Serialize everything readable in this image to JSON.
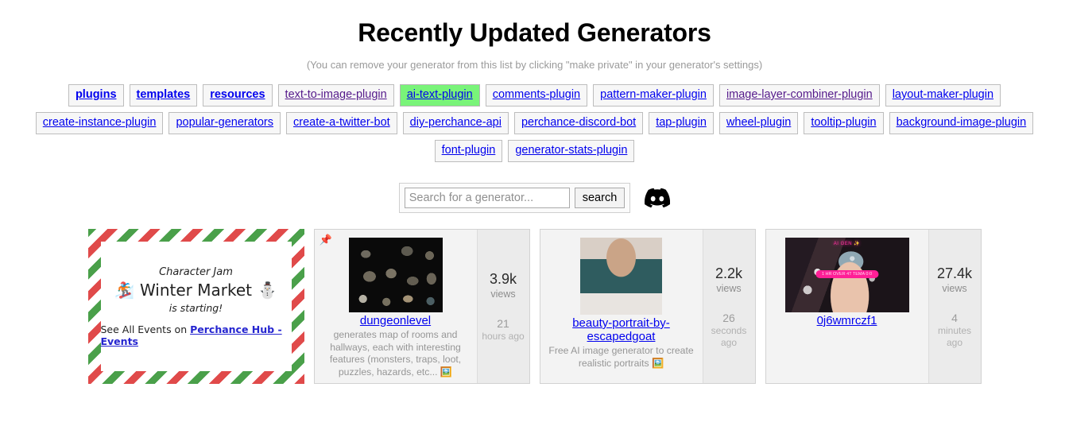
{
  "header": {
    "title": "Recently Updated Generators",
    "subtitle": "(You can remove your generator from this list by clicking \"make private\" in your generator's settings)"
  },
  "tag_rows": [
    [
      {
        "label": "plugins",
        "style": "bold"
      },
      {
        "label": "templates",
        "style": "bold"
      },
      {
        "label": "resources",
        "style": "bold"
      },
      {
        "label": "text-to-image-plugin",
        "style": "visited"
      },
      {
        "label": "ai-text-plugin",
        "style": "highlight"
      },
      {
        "label": "comments-plugin",
        "style": "normal"
      },
      {
        "label": "pattern-maker-plugin",
        "style": "normal"
      },
      {
        "label": "image-layer-combiner-plugin",
        "style": "visited"
      },
      {
        "label": "layout-maker-plugin",
        "style": "normal"
      }
    ],
    [
      {
        "label": "create-instance-plugin",
        "style": "normal"
      },
      {
        "label": "popular-generators",
        "style": "normal"
      },
      {
        "label": "create-a-twitter-bot",
        "style": "normal"
      },
      {
        "label": "diy-perchance-api",
        "style": "normal"
      },
      {
        "label": "perchance-discord-bot",
        "style": "normal"
      },
      {
        "label": "tap-plugin",
        "style": "normal"
      },
      {
        "label": "wheel-plugin",
        "style": "normal"
      },
      {
        "label": "tooltip-plugin",
        "style": "normal"
      },
      {
        "label": "background-image-plugin",
        "style": "normal"
      }
    ],
    [
      {
        "label": "font-plugin",
        "style": "normal"
      },
      {
        "label": "generator-stats-plugin",
        "style": "normal"
      }
    ]
  ],
  "search": {
    "placeholder": "Search for a generator...",
    "value": "",
    "button_label": "search",
    "discord_icon": "discord-icon"
  },
  "event_card": {
    "jam_label": "Character Jam",
    "emoji_left": "🏂",
    "main_label": "Winter Market",
    "emoji_right": "⛄",
    "starting_label": "is starting!",
    "footer_prefix": "See All Events on",
    "footer_link": "Perchance Hub - Events",
    "border_colors": {
      "red": "#e04a4a",
      "green": "#4aa04a",
      "white": "#ffffff"
    }
  },
  "generators": [
    {
      "pinned": true,
      "pin_icon": "📌",
      "name": "dungeonlevel",
      "description": "generates map of rooms and hallways, each with interesting features (monsters, traps, loot, puzzles, hazards, etc... 🖼️",
      "views_count": "3.9k",
      "views_label": "views",
      "time_number": "21",
      "time_unit": "hours ago",
      "thumb": "dungeon-map-thumbnail"
    },
    {
      "pinned": false,
      "pin_icon": "",
      "name": "beauty-portrait-by-escapedgoat",
      "description": "Free AI image generator to create realistic portraits 🖼️",
      "views_count": "2.2k",
      "views_label": "views",
      "time_number": "26",
      "time_unit": "seconds ago",
      "thumb": "portrait-thumbnail"
    },
    {
      "pinned": false,
      "pin_icon": "",
      "name": "0j6wmrczf1",
      "description": "",
      "views_count": "27.4k",
      "views_label": "views",
      "time_number": "4",
      "time_unit": "minutes ago",
      "thumb": "anime-thumbnail",
      "thumb_overlay_top": "AI GEN ✨",
      "thumb_overlay_mid": "1 HR OVER 4T TEMA 0:0"
    }
  ],
  "colors": {
    "link": "#0000ee",
    "visited_link": "#551a8b",
    "highlight": "#79f479",
    "card_bg": "#f3f3f3",
    "side_bg": "#ebebeb",
    "muted_text": "#969696"
  }
}
